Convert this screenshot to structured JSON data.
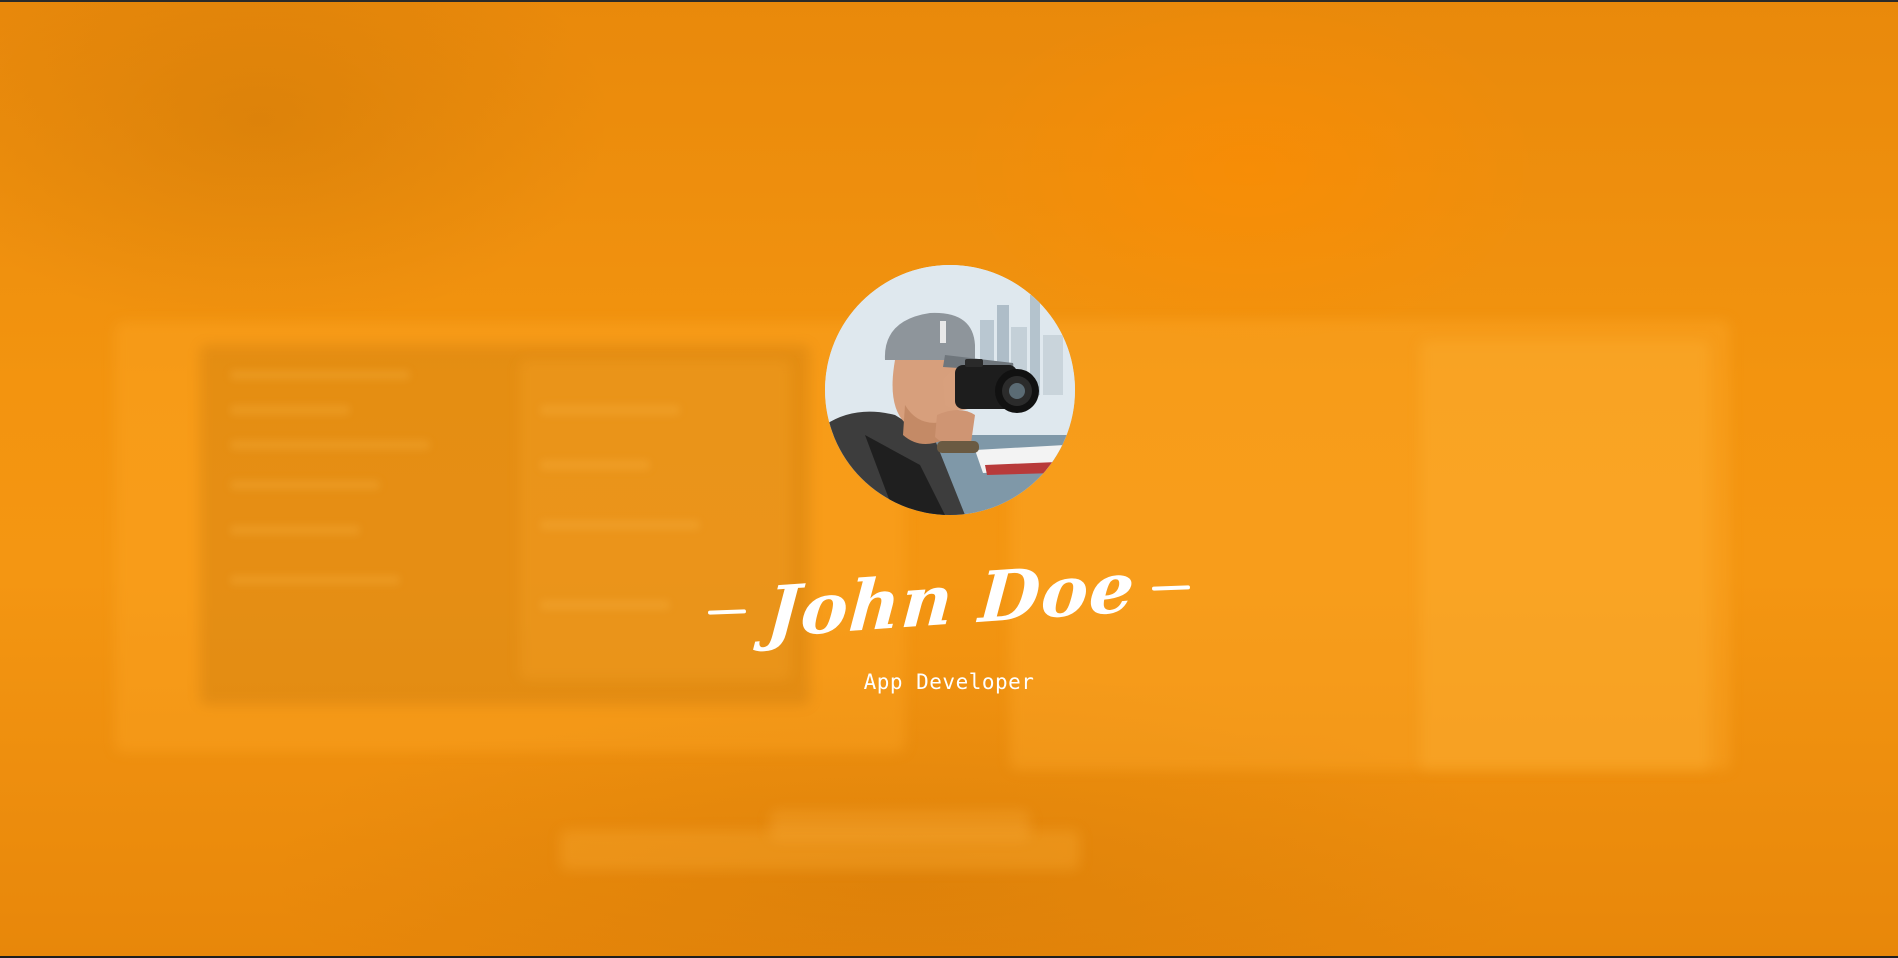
{
  "profile": {
    "name": "John Doe",
    "role": "App Developer",
    "avatar_icon": "photographer-avatar"
  },
  "colors": {
    "background": "#ef8d0c",
    "text": "#ffffff"
  }
}
